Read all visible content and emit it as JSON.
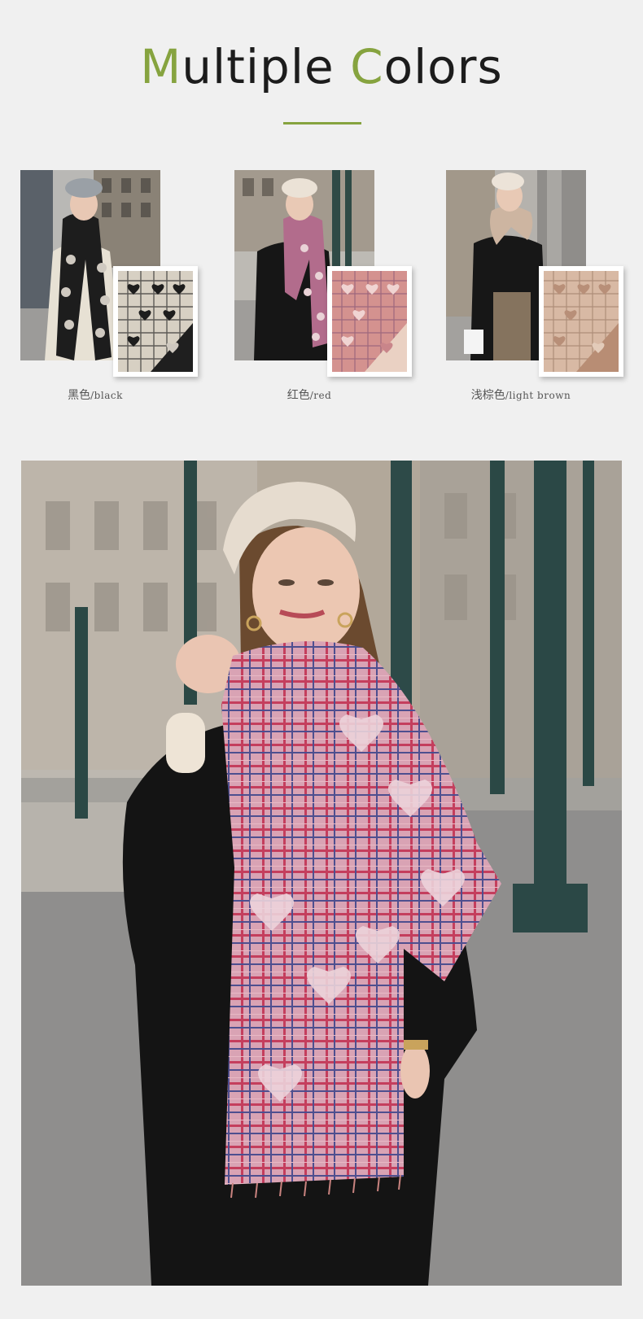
{
  "header": {
    "title_parts": [
      {
        "text": "M",
        "accent": true
      },
      {
        "text": "ultiple ",
        "accent": false
      },
      {
        "text": "C",
        "accent": true
      },
      {
        "text": "olors",
        "accent": false
      }
    ],
    "accent_color": "#86a33f"
  },
  "variants": [
    {
      "label_cn": "黑色",
      "label_en": "/black",
      "scarf_color": "#1d1d1d",
      "heart_color": "#cfc9c0",
      "swatch_base": "#2a2a2a",
      "plaid": "#c9c2b5"
    },
    {
      "label_cn": "红色",
      "label_en": "/red",
      "scarf_color": "#b26c8c",
      "heart_color": "#e9d2d6",
      "swatch_base": "#c98a8e",
      "plaid": "#e8c4c3"
    },
    {
      "label_cn": "浅棕色",
      "label_en": "/light brown",
      "scarf_color": "#cdb5a1",
      "heart_color": "#ead9ca",
      "swatch_base": "#c9a48d",
      "plaid": "#e2cdbd"
    }
  ],
  "main_photo": {
    "description_icon": "model-photo-icon",
    "scarf_color": "#c2647e",
    "coat_color": "#141414"
  }
}
